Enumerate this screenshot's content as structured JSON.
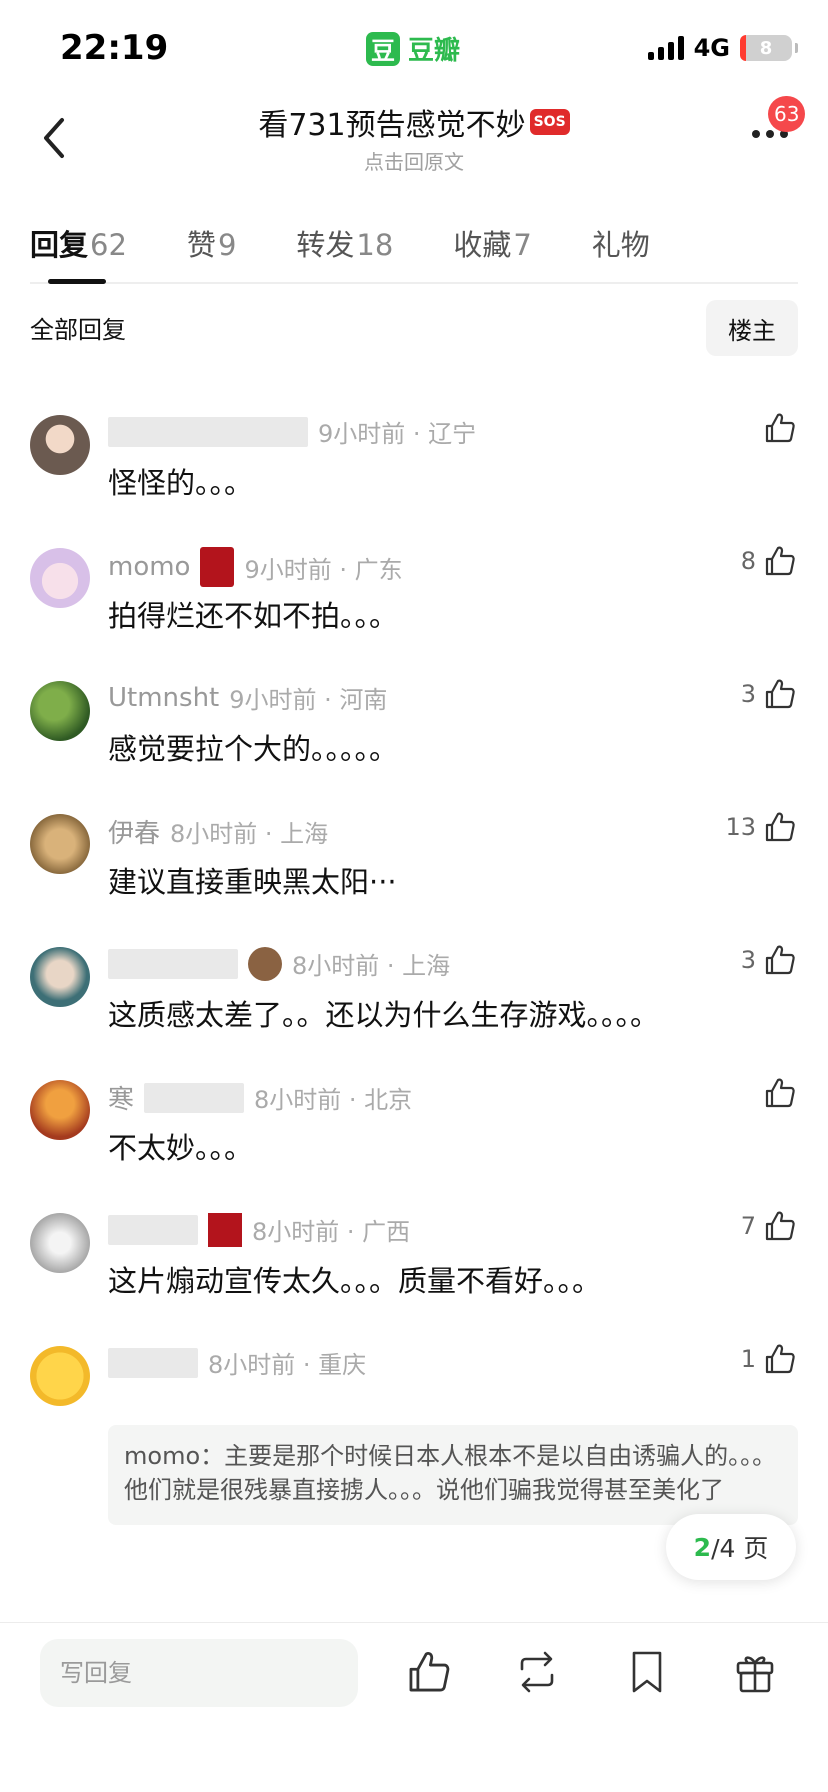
{
  "status_bar": {
    "time": "22:19",
    "app_name": "豆瓣",
    "app_logo_char": "豆",
    "network": "4G",
    "battery": "8"
  },
  "nav": {
    "title": "看731预告感觉不妙",
    "title_emoji": "SOS",
    "subtitle": "点击回原文",
    "badge": "63"
  },
  "tabs": [
    {
      "label": "回复",
      "count": "62"
    },
    {
      "label": "赞",
      "count": "9"
    },
    {
      "label": "转发",
      "count": "18"
    },
    {
      "label": "收藏",
      "count": "7"
    },
    {
      "label": "礼物",
      "count": ""
    }
  ],
  "filter": {
    "all": "全部回复",
    "owner": "楼主"
  },
  "comments": [
    {
      "name": "",
      "time": "9小时前 · 辽宁",
      "text": "怪怪的。。。",
      "likes": ""
    },
    {
      "name": "momo",
      "time": "9小时前 · 广东",
      "text": "拍得烂还不如不拍。。。",
      "likes": "8"
    },
    {
      "name": "Utmnsht",
      "time": "9小时前 · 河南",
      "text": "感觉要拉个大的。。。。。",
      "likes": "3"
    },
    {
      "name": "伊春",
      "time": "8小时前 · 上海",
      "text": "建议直接重映黑太阳···",
      "likes": "13"
    },
    {
      "name": "",
      "time": "8小时前 · 上海",
      "text": "这质感太差了。。还以为什么生存游戏。。。。",
      "likes": "3"
    },
    {
      "name": "寒",
      "time": "8小时前 · 北京",
      "text": "不太妙。。。",
      "likes": ""
    },
    {
      "name": "",
      "time": "8小时前 · 广西",
      "text": "这片煽动宣传太久。。。质量不看好。。。",
      "likes": "7"
    },
    {
      "name": "",
      "time": "8小时前 · 重庆",
      "text": "",
      "likes": "1"
    }
  ],
  "quote": {
    "author": "momo：",
    "text": "主要是那个时候日本人根本不是以自由诱骗人的。。。他们就是很残暴直接掳人。。。说他们骗我觉得甚至美化了"
  },
  "pager": {
    "current": "2",
    "total": "/4 页"
  },
  "bottom": {
    "reply_placeholder": "写回复"
  },
  "colors": {
    "brand_green": "#2dba4e",
    "badge_red": "#f5484b"
  },
  "icons": [
    "back-arrow-icon",
    "more-icon",
    "thumb-up-icon",
    "repost-icon",
    "bookmark-icon",
    "gift-icon"
  ]
}
